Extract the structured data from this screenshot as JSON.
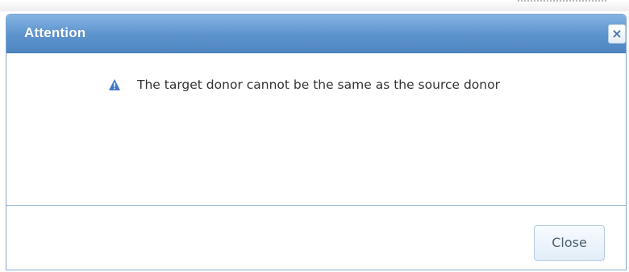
{
  "dialog": {
    "title": "Attention",
    "close_icon_glyph": "×",
    "message": {
      "icon": "warning-triangle-icon",
      "text": "The target donor cannot be the same as the source donor"
    },
    "footer": {
      "close_label": "Close"
    }
  },
  "colors": {
    "header_blue": "#5c93cd",
    "border_blue": "#7fa8d0",
    "icon_blue": "#3f78c4",
    "text": "#333333"
  }
}
